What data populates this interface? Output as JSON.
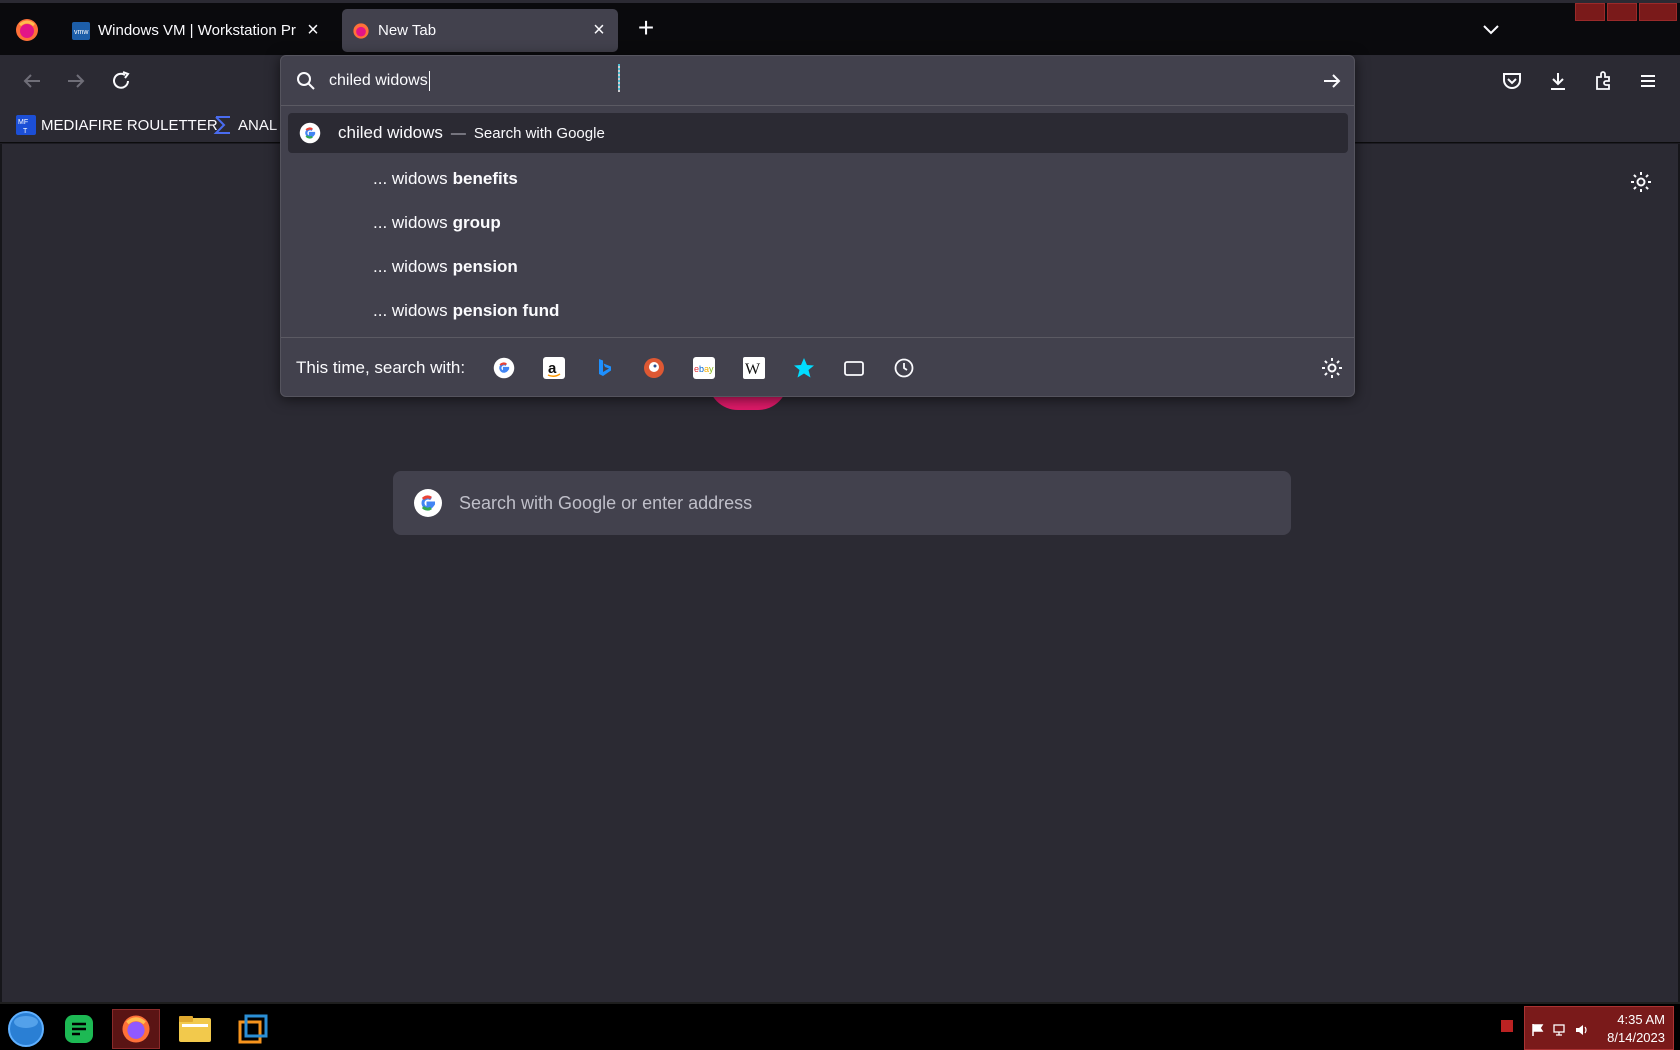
{
  "browser": {
    "tabs": [
      {
        "title": "Windows VM | Workstation Pro",
        "icon": "vmware-icon",
        "active": false
      },
      {
        "title": "New Tab",
        "icon": "firefox-icon",
        "active": true
      }
    ],
    "bookmarks": [
      {
        "label": "MEDIAFIRE ROULETTER",
        "icon": "mediafire-icon"
      },
      {
        "label": "ANAL",
        "icon": "sigma-icon"
      }
    ]
  },
  "urlbar": {
    "value": "chiled widows",
    "first_suggestion": {
      "query": "chiled widows",
      "dash": "—",
      "action": "Search with Google"
    },
    "suggestions": [
      {
        "prefix": "... widows",
        "bold": "benefits"
      },
      {
        "prefix": "... widows",
        "bold": "group"
      },
      {
        "prefix": "... widows",
        "bold": "pension"
      },
      {
        "prefix": "... widows",
        "bold": "pension fund"
      }
    ],
    "oneoff_label": "This time, search with:",
    "oneoff_engines": [
      "google-icon",
      "amazon-icon",
      "bing-icon",
      "duckduckgo-icon",
      "ebay-icon",
      "wikipedia-icon",
      "bookmarks-star-icon",
      "tabs-icon",
      "history-icon"
    ]
  },
  "newtab": {
    "search_placeholder": "Search with Google or enter address"
  },
  "taskbar": {
    "time": "4:35 AM",
    "date": "8/14/2023"
  },
  "colors": {
    "accent": "#0df",
    "toolbar": "#2b2a33",
    "panel": "#42414d",
    "tray": "#7a1a1a"
  }
}
